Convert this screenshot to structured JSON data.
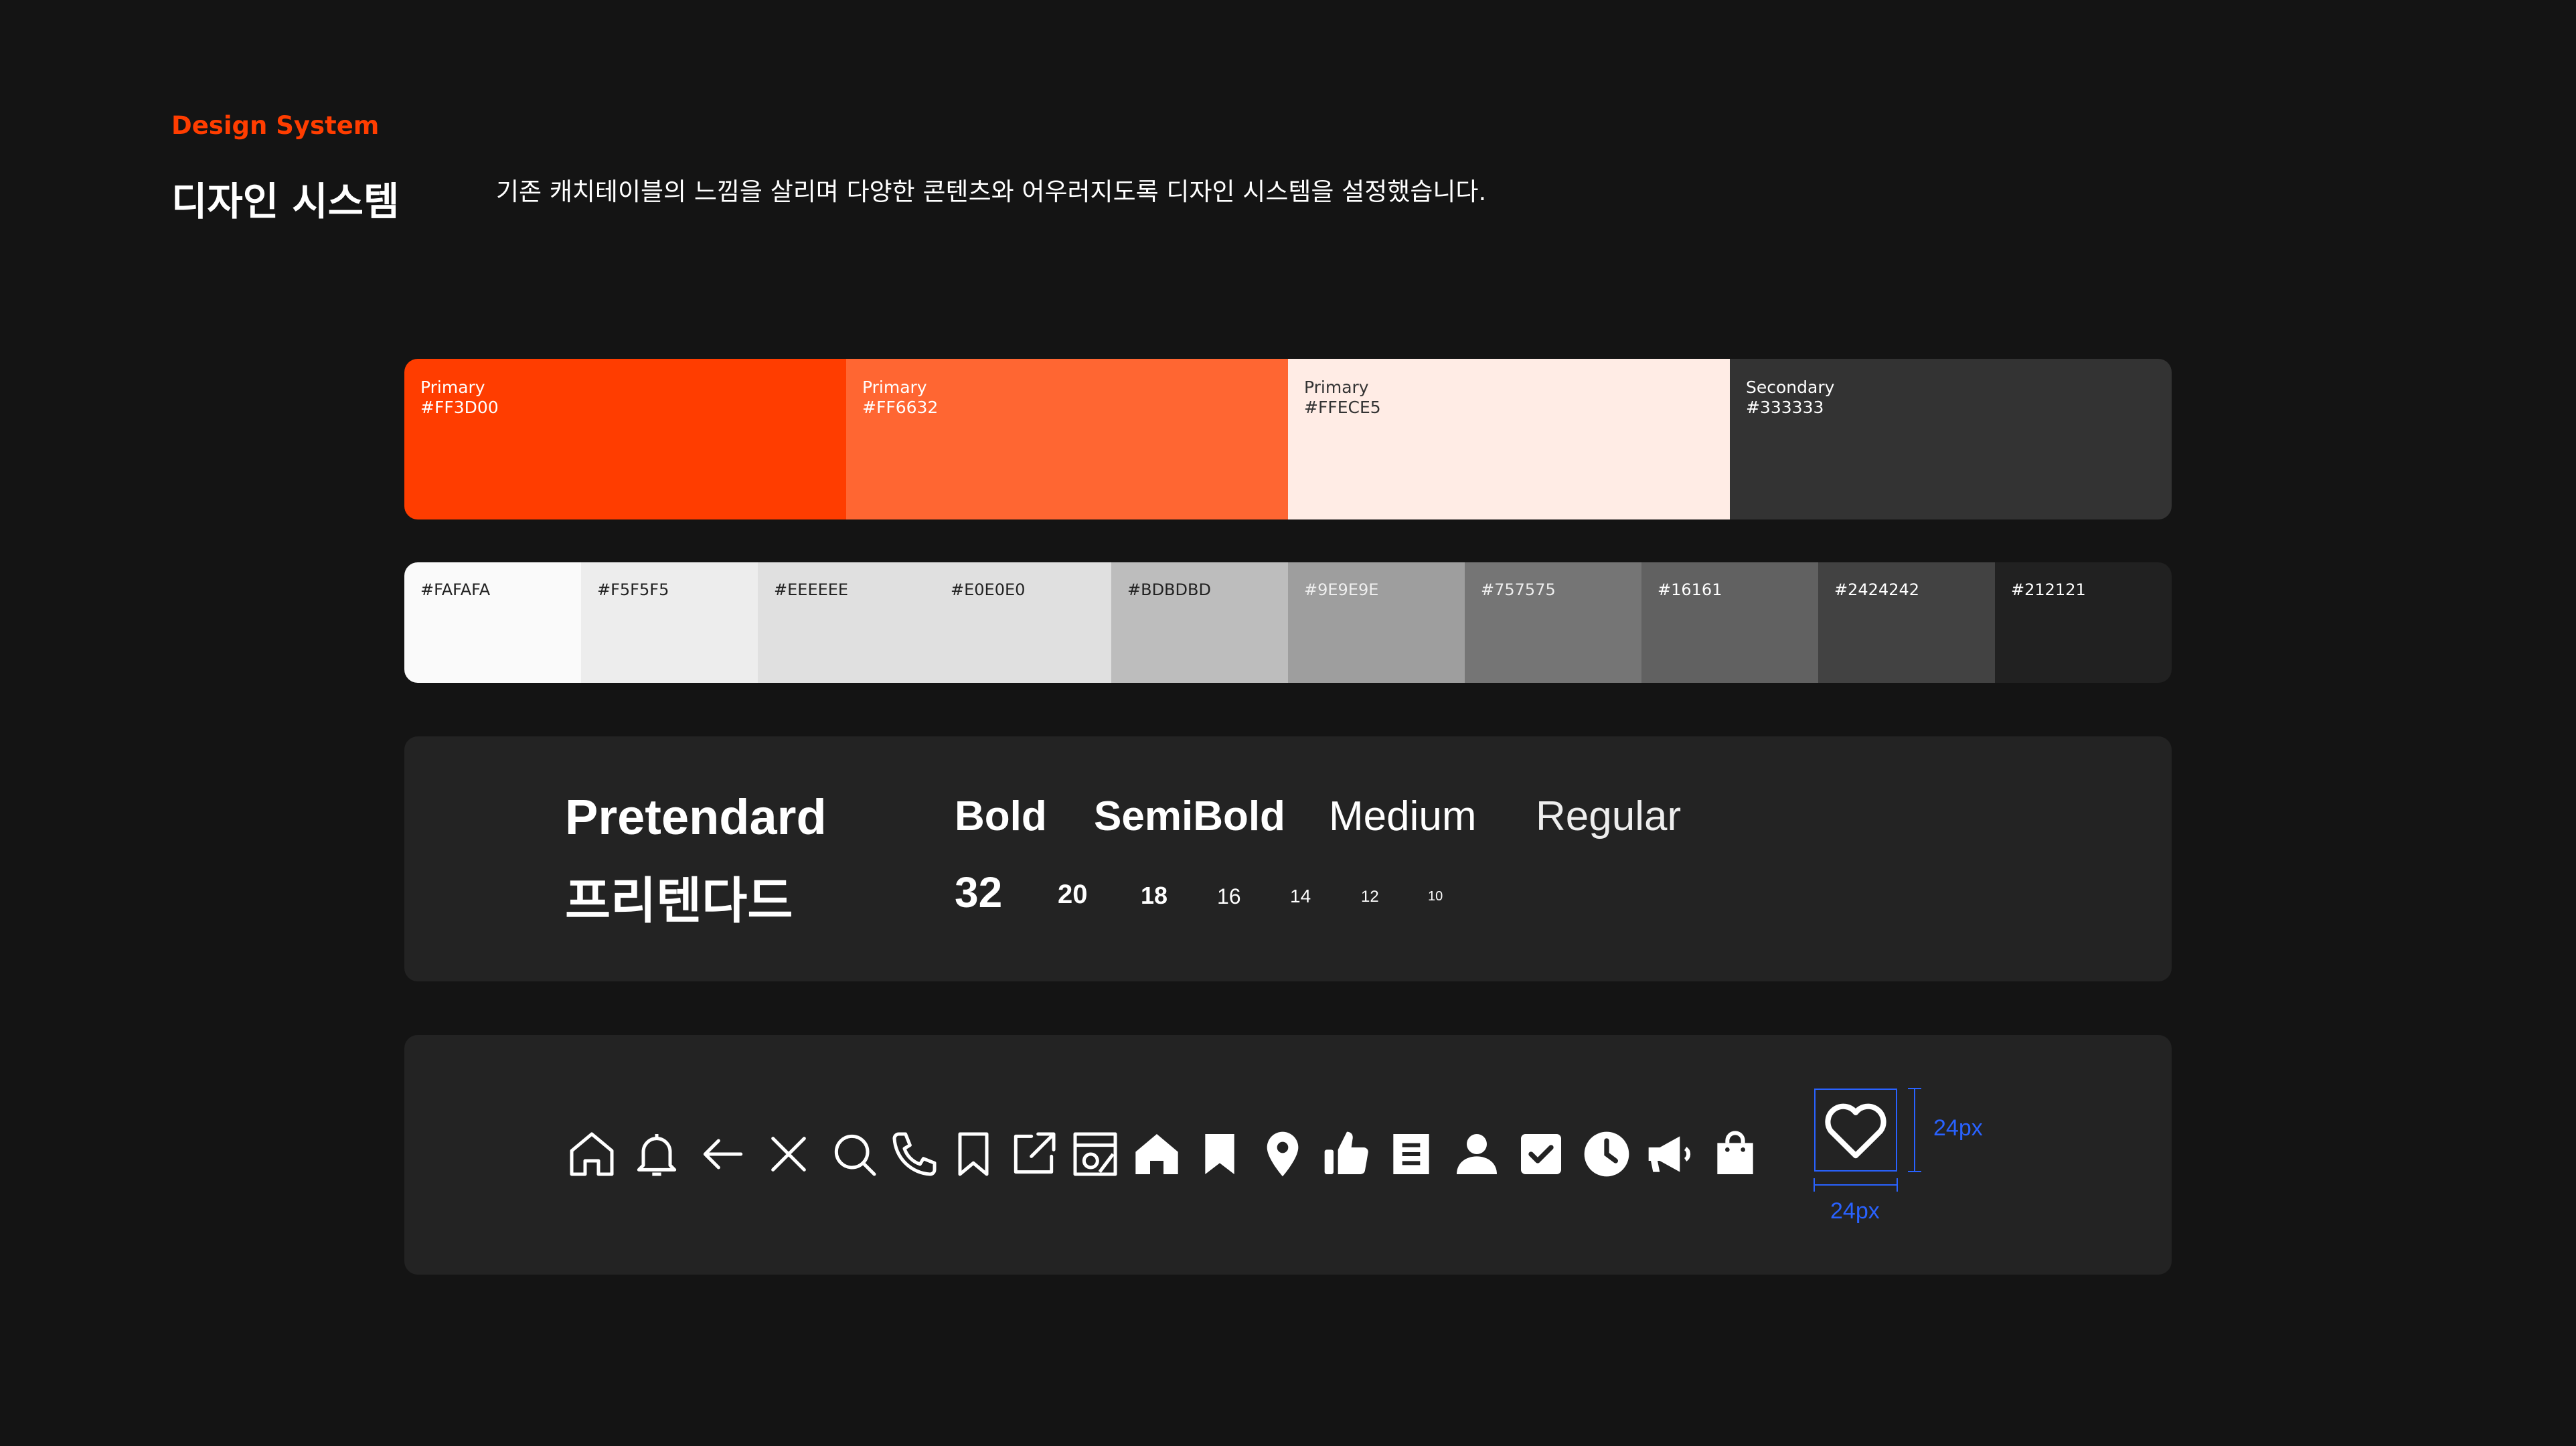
{
  "header": {
    "eyebrow": "Design System",
    "title": "디자인 시스템",
    "description": "기존 캐치테이블의 느낌을 살리며 다양한 콘텐츠와 어우러지도록 디자인 시스템을 설정했습니다."
  },
  "primary_colors": [
    {
      "name": "Primary",
      "hex": "#FF3D00",
      "fill": "#FF3D00",
      "text_color": "#FFFFFF"
    },
    {
      "name": "Primary",
      "hex": "#FF6632",
      "fill": "#FF6632",
      "text_color": "#FFFFFF"
    },
    {
      "name": "Primary",
      "hex": "#FFECE5",
      "fill": "#FFECE5",
      "text_color": "#333333"
    },
    {
      "name": "Secondary",
      "hex": "#333333",
      "fill": "#333333",
      "text_color": "#FFFFFF"
    }
  ],
  "gray_colors": [
    {
      "hex": "#FAFAFA",
      "fill": "#FAFAFA",
      "text_color": "#222222"
    },
    {
      "hex": "#F5F5F5",
      "fill": "#EDEDED",
      "text_color": "#222222"
    },
    {
      "hex": "#EEEEEE",
      "fill": "#E0E0E0",
      "text_color": "#222222"
    },
    {
      "hex": "#E0E0E0",
      "fill": "#E0E0E0",
      "text_color": "#222222"
    },
    {
      "hex": "#BDBDBD",
      "fill": "#BDBDBD",
      "text_color": "#222222"
    },
    {
      "hex": "#9E9E9E",
      "fill": "#9E9E9E",
      "text_color": "#EEEEEE"
    },
    {
      "hex": "#757575",
      "fill": "#757575",
      "text_color": "#EEEEEE"
    },
    {
      "hex": "#16161",
      "fill": "#616161",
      "text_color": "#FFFFFF"
    },
    {
      "hex": "#2424242",
      "fill": "#424242",
      "text_color": "#FFFFFF"
    },
    {
      "hex": "#212121",
      "fill": "#212121",
      "text_color": "#FFFFFF"
    }
  ],
  "typography": {
    "font_name_en": "Pretendard",
    "font_name_ko": "프리텐다드",
    "weights": [
      "Bold",
      "SemiBold",
      "Medium",
      "Regular"
    ],
    "sizes": [
      "32",
      "20",
      "18",
      "16",
      "14",
      "12",
      "10"
    ]
  },
  "icons": [
    "home-outline-icon",
    "bell-outline-icon",
    "arrow-left-icon",
    "close-icon",
    "search-icon",
    "phone-icon",
    "bookmark-outline-icon",
    "external-link-icon",
    "image-gallery-icon",
    "home-filled-icon",
    "bookmark-filled-icon",
    "location-pin-icon",
    "thumbs-up-icon",
    "document-icon",
    "user-icon",
    "checkbox-icon",
    "clock-icon",
    "megaphone-icon",
    "shopping-bag-icon"
  ],
  "icon_spec": {
    "example_icon": "heart-icon",
    "width_label": "24px",
    "height_label": "24px",
    "guide_color": "#2962FF"
  }
}
